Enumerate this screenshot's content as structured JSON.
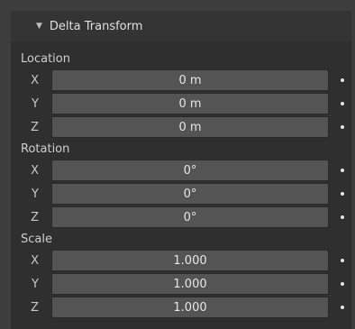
{
  "panel": {
    "title": "Delta Transform",
    "collapse_icon": "triangle-down-icon"
  },
  "groups": [
    {
      "label": "Location",
      "rows": [
        {
          "axis": "X",
          "value": "0 m"
        },
        {
          "axis": "Y",
          "value": "0 m"
        },
        {
          "axis": "Z",
          "value": "0 m"
        }
      ]
    },
    {
      "label": "Rotation",
      "rows": [
        {
          "axis": "X",
          "value": "0°"
        },
        {
          "axis": "Y",
          "value": "0°"
        },
        {
          "axis": "Z",
          "value": "0°"
        }
      ]
    },
    {
      "label": "Scale",
      "rows": [
        {
          "axis": "X",
          "value": "1.000"
        },
        {
          "axis": "Y",
          "value": "1.000"
        },
        {
          "axis": "Z",
          "value": "1.000"
        }
      ]
    }
  ]
}
